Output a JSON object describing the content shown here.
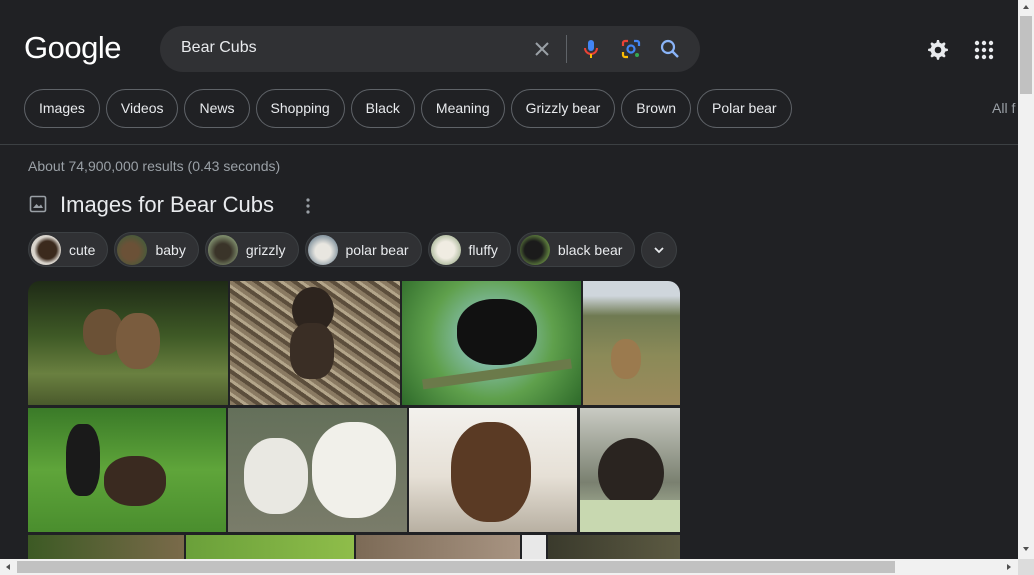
{
  "header": {
    "logo": "Google",
    "search": {
      "query": "Bear Cubs"
    },
    "icons": [
      "close-icon",
      "mic-icon",
      "lens-icon",
      "search-icon",
      "settings-gear-icon",
      "apps-grid-icon"
    ]
  },
  "filters": [
    "Images",
    "Videos",
    "News",
    "Shopping",
    "Black",
    "Meaning",
    "Grizzly bear",
    "Brown",
    "Polar bear"
  ],
  "all_filters": "All f",
  "results_stats": "About 74,900,000 results (0.43 seconds)",
  "images_section": {
    "title": "Images for Bear Cubs",
    "refinements": [
      "cute",
      "baby",
      "grizzly",
      "polar bear",
      "fluffy",
      "black bear"
    ]
  },
  "colors": {
    "background": "#202124",
    "search_bg": "#303134",
    "chip_border": "#5f6368",
    "text": "#e8eaed",
    "muted_text": "#9aa0a6",
    "accent_blue": "#8ab4f8"
  }
}
